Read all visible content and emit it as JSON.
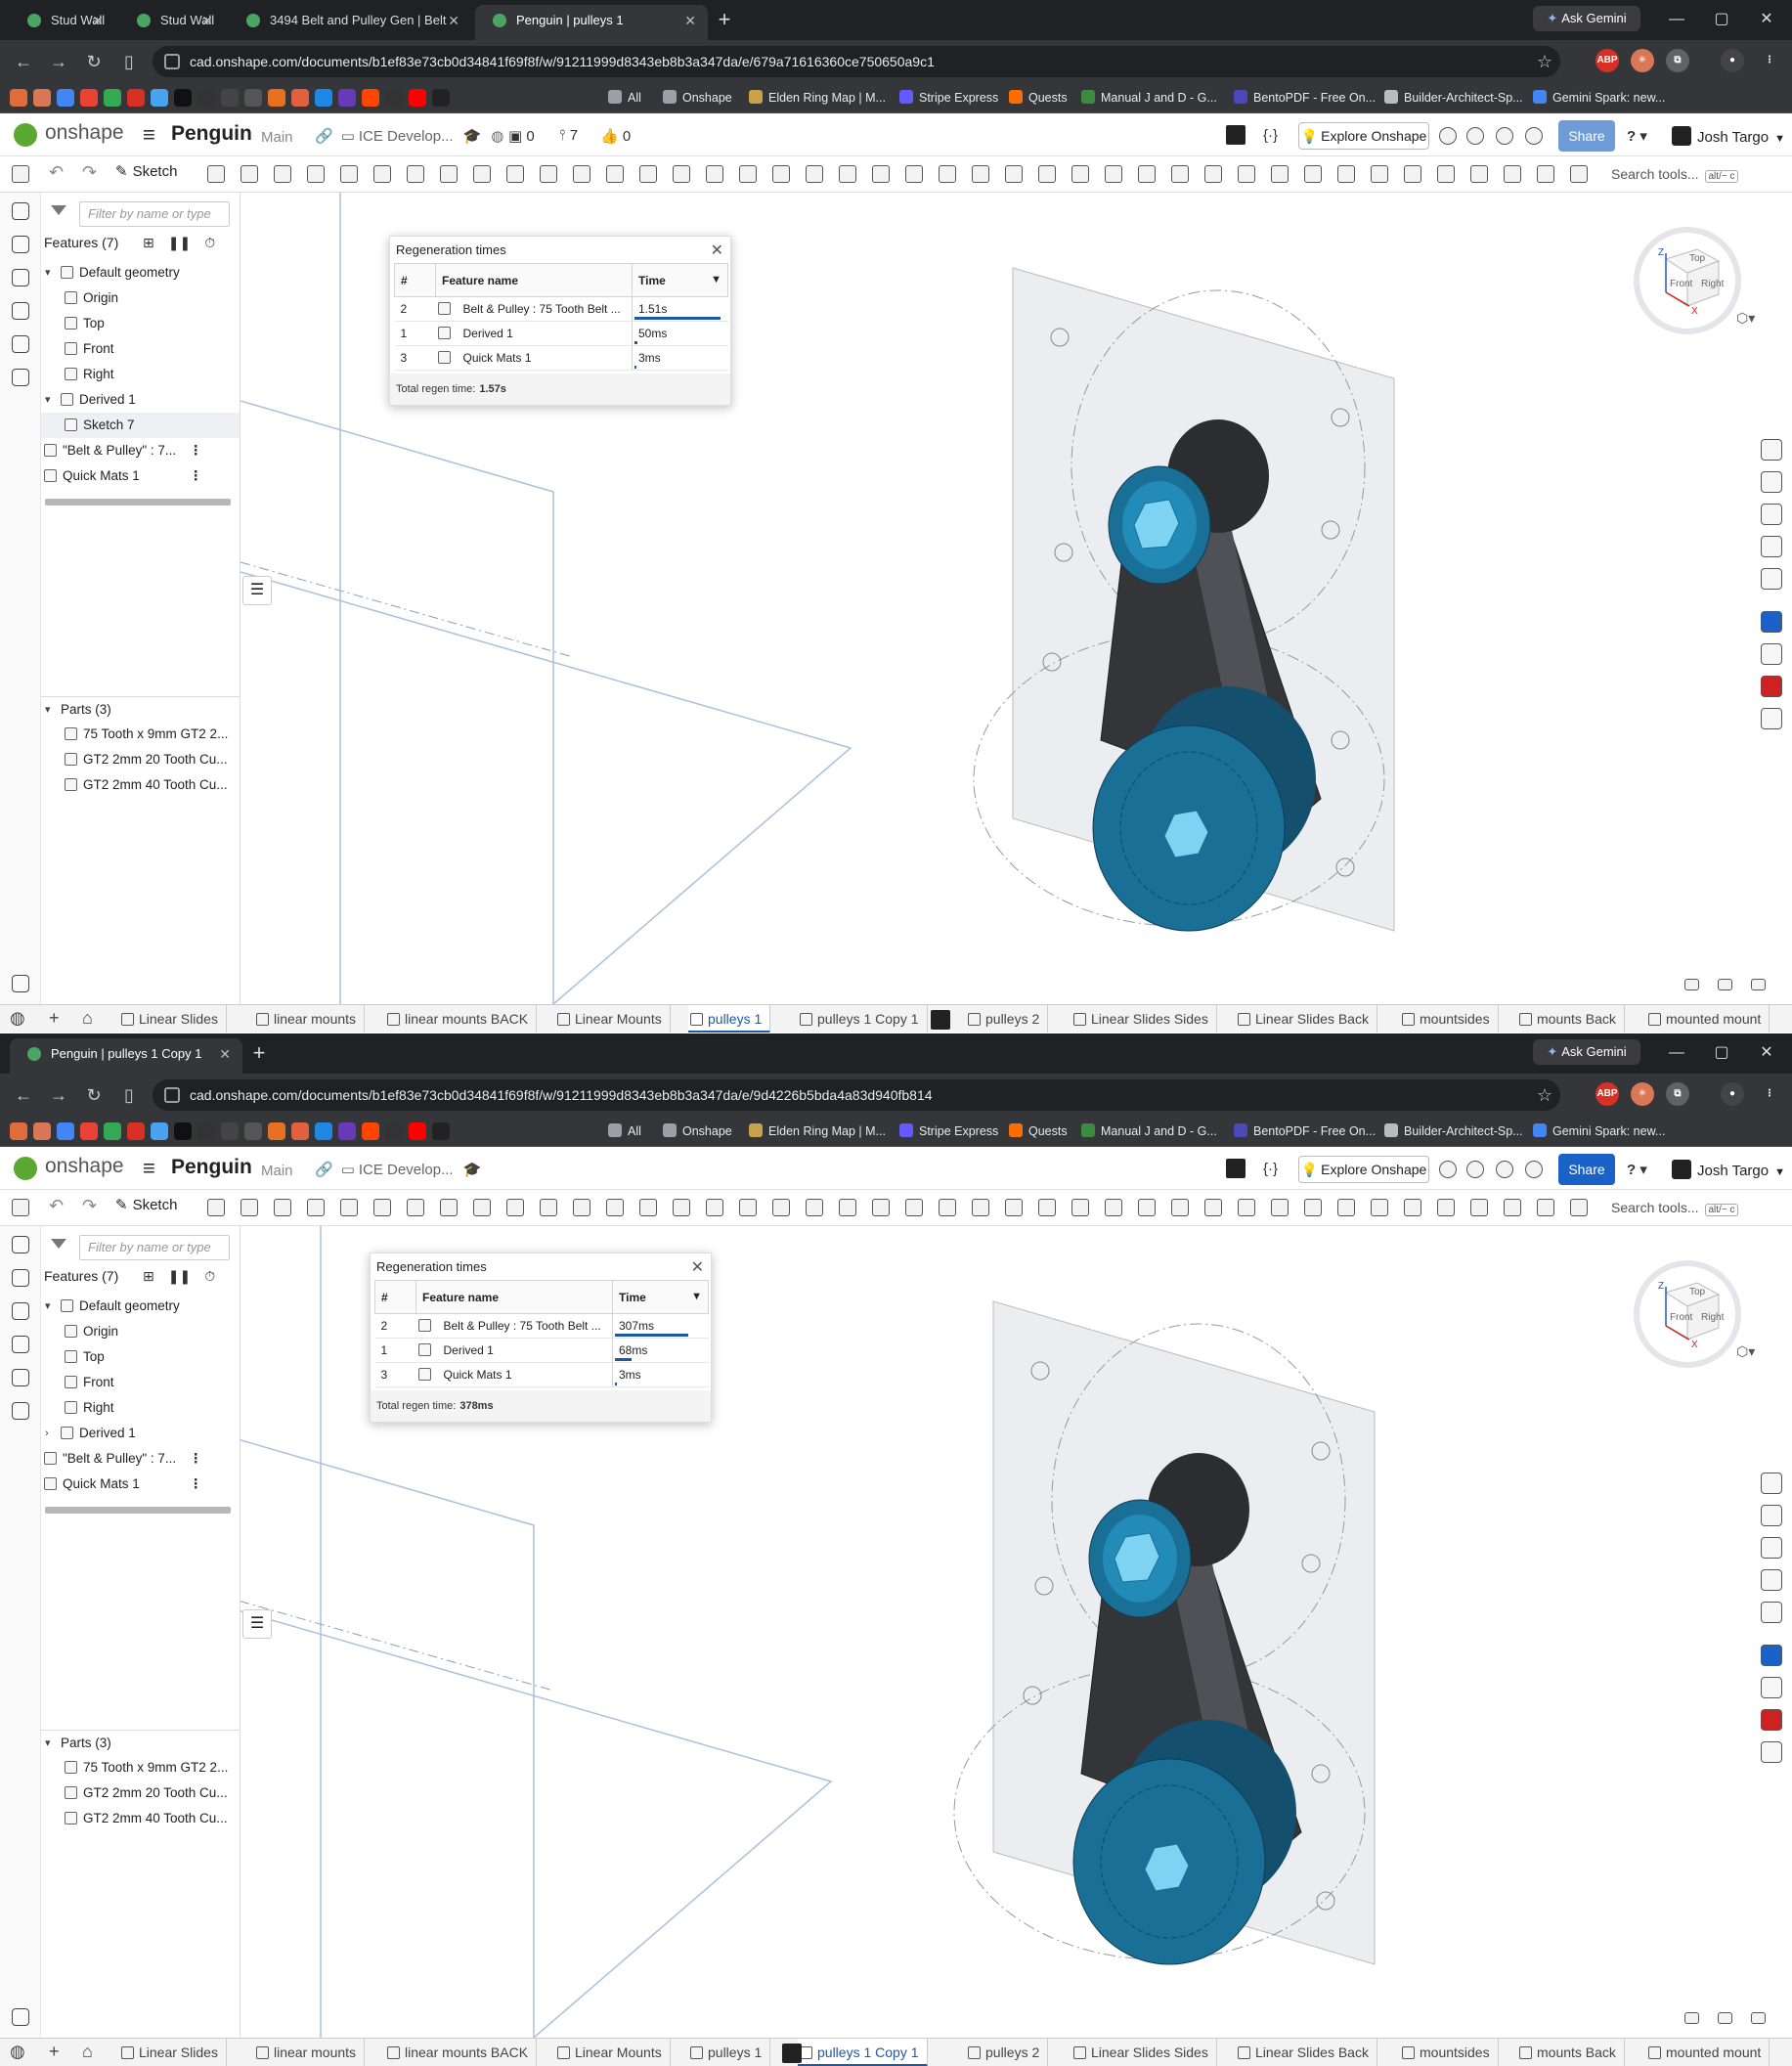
{
  "windows": [
    {
      "browser_tabs": [
        {
          "label": "Stud Wall",
          "active": false
        },
        {
          "label": "Stud Wall",
          "active": false
        },
        {
          "label": "3494 Belt and Pulley Gen | Belt",
          "active": false
        },
        {
          "label": "Penguin | pulleys 1",
          "active": true
        }
      ],
      "ask_gemini": "Ask Gemini",
      "url": "cad.onshape.com/documents/b1ef83e73cb0d34841f69f8f/w/91211999d8343eb8b3a347da/e/679a71616360ce750650a9c1",
      "bookmarks": [
        "All",
        "Onshape",
        "Elden Ring Map | M...",
        "Stripe Express",
        "Quests",
        "Manual J and D - G...",
        "BentoPDF - Free On...",
        "Builder-Architect-Sp...",
        "Gemini Spark: new..."
      ],
      "app_name": "onshape",
      "doc_title": "Penguin",
      "branch": "Main",
      "folder": "ICE Develop...",
      "counts": {
        "versions": "0",
        "branches": "7",
        "likes": "0"
      },
      "explore": "Explore Onshape",
      "share": "Share",
      "user": "Josh Targo",
      "sketch": "Sketch",
      "search_tools": "Search tools...",
      "search_shortcut": "alt/~ c",
      "filter_placeholder": "Filter by name or type",
      "features_title": "Features (7)",
      "feature_tree": [
        {
          "label": "Default geometry",
          "indent": 0,
          "chev": "down"
        },
        {
          "label": "Origin",
          "indent": 1
        },
        {
          "label": "Top",
          "indent": 1
        },
        {
          "label": "Front",
          "indent": 1
        },
        {
          "label": "Right",
          "indent": 1
        },
        {
          "label": "Derived 1",
          "indent": 0,
          "chev": "down"
        },
        {
          "label": "Sketch 7",
          "indent": 1,
          "selected": true
        },
        {
          "label": "\"Belt & Pulley\" : 7...",
          "indent": 0,
          "kebab": true
        },
        {
          "label": "Quick Mats 1",
          "indent": 0,
          "kebab": true
        }
      ],
      "parts_title": "Parts (3)",
      "parts": [
        "75 Tooth x 9mm GT2 2...",
        "GT2 2mm 20 Tooth Cu...",
        "GT2 2mm 40 Tooth Cu..."
      ],
      "regen": {
        "title": "Regeneration times",
        "headers": [
          "#",
          "Feature name",
          "Time"
        ],
        "rows": [
          {
            "num": "2",
            "name": "Belt & Pulley : 75 Tooth Belt ...",
            "time": "1.51s",
            "fraction": 0.96
          },
          {
            "num": "1",
            "name": "Derived 1",
            "time": "50ms",
            "fraction": 0.03
          },
          {
            "num": "3",
            "name": "Quick Mats 1",
            "time": "3ms",
            "fraction": 0.0
          }
        ],
        "total_label": "Total regen time:",
        "total_value": "1.57s"
      },
      "bottom_tabs": [
        {
          "label": "Linear Slides"
        },
        {
          "label": "linear mounts"
        },
        {
          "label": "linear mounts BACK"
        },
        {
          "label": "Linear Mounts"
        },
        {
          "label": "pulleys 1",
          "active": true
        },
        {
          "label": "pulleys 1 Copy 1"
        },
        {
          "label": "pulleys 2"
        },
        {
          "label": "Linear Slides Sides"
        },
        {
          "label": "Linear Slides Back"
        },
        {
          "label": "mountsides"
        },
        {
          "label": "mounts Back"
        },
        {
          "label": "mounted mount"
        }
      ]
    },
    {
      "browser_tabs": [
        {
          "label": "Penguin | pulleys 1 Copy 1",
          "active": true
        }
      ],
      "ask_gemini": "Ask Gemini",
      "url": "cad.onshape.com/documents/b1ef83e73cb0d34841f69f8f/w/91211999d8343eb8b3a347da/e/9d4226b5bda4a83d940fb814",
      "bookmarks": [
        "All",
        "Onshape",
        "Elden Ring Map | M...",
        "Stripe Express",
        "Quests",
        "Manual J and D - G...",
        "BentoPDF - Free On...",
        "Builder-Architect-Sp...",
        "Gemini Spark: new..."
      ],
      "app_name": "onshape",
      "doc_title": "Penguin",
      "branch": "Main",
      "folder": "ICE Develop...",
      "counts": null,
      "explore": "Explore Onshape",
      "share": "Share",
      "user": "Josh Targo",
      "sketch": "Sketch",
      "search_tools": "Search tools...",
      "search_shortcut": "alt/~ c",
      "filter_placeholder": "Filter by name or type",
      "features_title": "Features (7)",
      "feature_tree": [
        {
          "label": "Default geometry",
          "indent": 0,
          "chev": "down"
        },
        {
          "label": "Origin",
          "indent": 1
        },
        {
          "label": "Top",
          "indent": 1
        },
        {
          "label": "Front",
          "indent": 1
        },
        {
          "label": "Right",
          "indent": 1
        },
        {
          "label": "Derived 1",
          "indent": 0,
          "chev": "right"
        },
        {
          "label": "\"Belt & Pulley\" : 7...",
          "indent": 0,
          "kebab": true
        },
        {
          "label": "Quick Mats 1",
          "indent": 0,
          "kebab": true
        }
      ],
      "parts_title": "Parts (3)",
      "parts": [
        "75 Tooth x 9mm GT2 2...",
        "GT2 2mm 20 Tooth Cu...",
        "GT2 2mm 40 Tooth Cu..."
      ],
      "regen": {
        "title": "Regeneration times",
        "headers": [
          "#",
          "Feature name",
          "Time"
        ],
        "rows": [
          {
            "num": "2",
            "name": "Belt & Pulley : 75 Tooth Belt ...",
            "time": "307ms",
            "fraction": 0.81
          },
          {
            "num": "1",
            "name": "Derived 1",
            "time": "68ms",
            "fraction": 0.18
          },
          {
            "num": "3",
            "name": "Quick Mats 1",
            "time": "3ms",
            "fraction": 0.0
          }
        ],
        "total_label": "Total regen time:",
        "total_value": "378ms"
      },
      "bottom_tabs": [
        {
          "label": "Linear Slides"
        },
        {
          "label": "linear mounts"
        },
        {
          "label": "linear mounts BACK"
        },
        {
          "label": "Linear Mounts"
        },
        {
          "label": "pulleys 1"
        },
        {
          "label": "pulleys 1 Copy 1",
          "active": true
        },
        {
          "label": "pulleys 2"
        },
        {
          "label": "Linear Slides Sides"
        },
        {
          "label": "Linear Slides Back"
        },
        {
          "label": "mountsides"
        },
        {
          "label": "mounts Back"
        },
        {
          "label": "mounted mount"
        }
      ]
    }
  ],
  "viewcube": {
    "top": "Top",
    "front": "Front",
    "right": "Right",
    "z": "Z",
    "x": "X"
  },
  "colors": {
    "pulley": "#1a6f96",
    "pulley_light": "#2aa8d8",
    "belt": "#333438",
    "accent": "#1b58a6",
    "share": "#1a62c7"
  }
}
